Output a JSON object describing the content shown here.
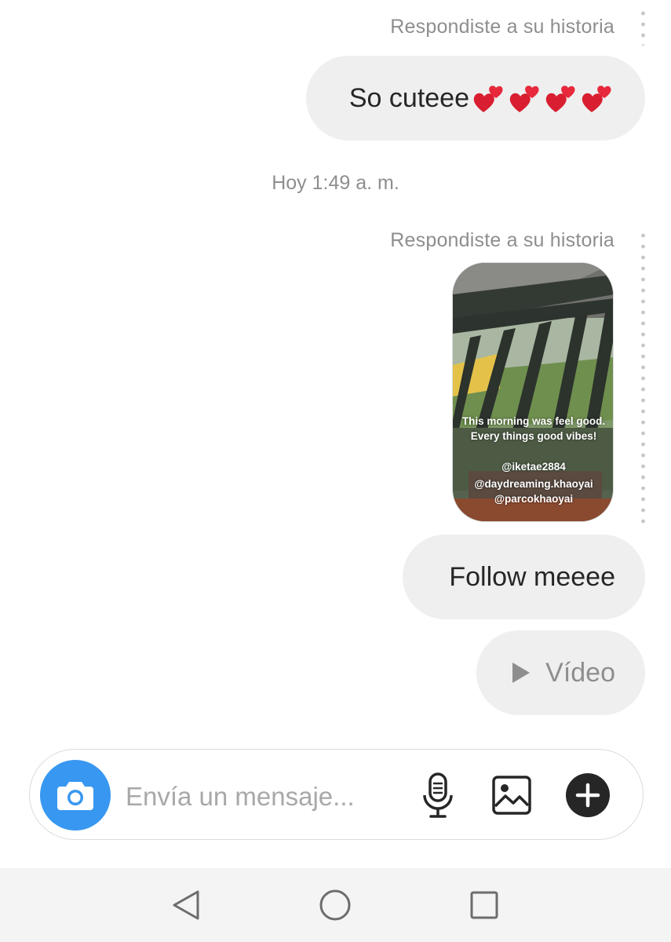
{
  "thread": {
    "reply_label_1": "Respondiste a su historia",
    "message_1": "So cuteee",
    "message_1_emoji": "two-hearts-emoji",
    "timestamp": "Hoy 1:49 a. m.",
    "reply_label_2": "Respondiste a su historia",
    "story_caption": [
      "This morning was feel good.",
      "Every things good vibes!"
    ],
    "story_tags": [
      "@iketae2884",
      "@daydreaming.khaoyai",
      "@parcokhaoyai"
    ],
    "message_2": "Follow meeee",
    "message_3": "Vídeo"
  },
  "composer": {
    "placeholder": "Envía un mensaje...",
    "icons": [
      "camera-icon",
      "microphone-icon",
      "gallery-icon",
      "plus-icon"
    ],
    "camera_color": "#3897f0"
  },
  "navbar": {
    "icons": [
      "back-icon",
      "home-icon",
      "recents-icon"
    ]
  },
  "colors": {
    "bubble": "#efefef",
    "meta_text": "#8e8e8e",
    "text": "#262626"
  }
}
